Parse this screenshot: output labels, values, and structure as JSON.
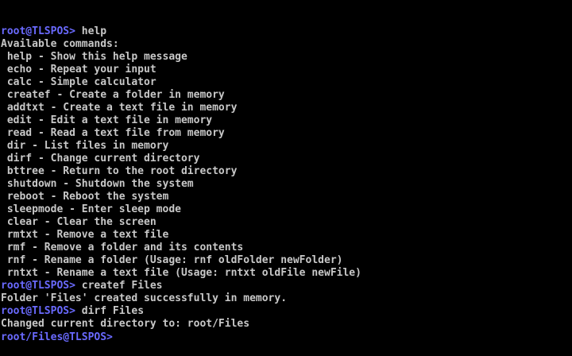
{
  "theme": {
    "background": "#000000",
    "text_color": "#c8c8c8",
    "prompt_color": "#6a6aff"
  },
  "terminal": {
    "lines": [
      {
        "type": "input",
        "prompt": "root@TLSPOS>",
        "command": " help"
      },
      {
        "type": "output",
        "text": "Available commands:"
      },
      {
        "type": "output",
        "text": " help - Show this help message"
      },
      {
        "type": "output",
        "text": " echo - Repeat your input"
      },
      {
        "type": "output",
        "text": " calc - Simple calculator"
      },
      {
        "type": "output",
        "text": " createf - Create a folder in memory"
      },
      {
        "type": "output",
        "text": " addtxt - Create a text file in memory"
      },
      {
        "type": "output",
        "text": " edit - Edit a text file in memory"
      },
      {
        "type": "output",
        "text": " read - Read a text file from memory"
      },
      {
        "type": "output",
        "text": " dir - List files in memory"
      },
      {
        "type": "output",
        "text": " dirf - Change current directory"
      },
      {
        "type": "output",
        "text": " bttree - Return to the root directory"
      },
      {
        "type": "output",
        "text": " shutdown - Shutdown the system"
      },
      {
        "type": "output",
        "text": " reboot - Reboot the system"
      },
      {
        "type": "output",
        "text": " sleepmode - Enter sleep mode"
      },
      {
        "type": "output",
        "text": " clear - Clear the screen"
      },
      {
        "type": "output",
        "text": " rmtxt - Remove a text file"
      },
      {
        "type": "output",
        "text": " rmf - Remove a folder and its contents"
      },
      {
        "type": "output",
        "text": " rnf - Rename a folder (Usage: rnf oldFolder newFolder)"
      },
      {
        "type": "output",
        "text": " rntxt - Rename a text file (Usage: rntxt oldFile newFile)"
      },
      {
        "type": "input",
        "prompt": "root@TLSPOS>",
        "command": " createf Files"
      },
      {
        "type": "output",
        "text": "Folder 'Files' created successfully in memory."
      },
      {
        "type": "input",
        "prompt": "root@TLSPOS>",
        "command": " dirf Files"
      },
      {
        "type": "output",
        "text": "Changed current directory to: root/Files"
      },
      {
        "type": "input",
        "prompt": "root/Files@TLSPOS>",
        "command": ""
      }
    ]
  }
}
